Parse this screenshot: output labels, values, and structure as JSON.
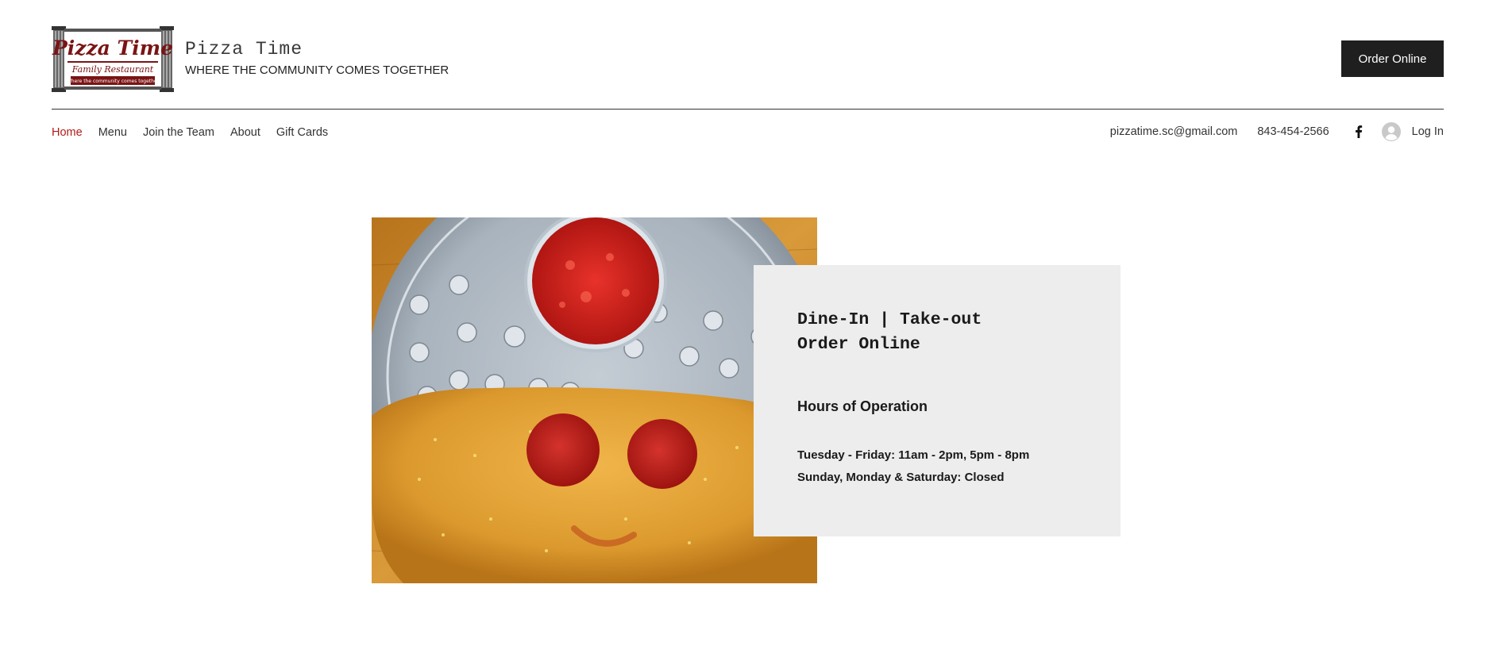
{
  "header": {
    "logo_text": "Pizza Time",
    "logo_subtitle": "Family Restaurant",
    "logo_tagline": "Where the community comes together",
    "site_name": "Pizza Time",
    "tagline": "WHERE THE COMMUNITY COMES TOGETHER",
    "order_button": "Order Online"
  },
  "nav": {
    "items": [
      {
        "label": "Home",
        "active": true
      },
      {
        "label": "Menu",
        "active": false
      },
      {
        "label": "Join the Team",
        "active": false
      },
      {
        "label": "About",
        "active": false
      },
      {
        "label": "Gift Cards",
        "active": false
      }
    ]
  },
  "contact": {
    "email": "pizzatime.sc@gmail.com",
    "phone": "843-454-2566",
    "social_icon": "facebook-icon",
    "login_label": "Log In"
  },
  "hero": {
    "image_alt": "calzone-with-marinara",
    "line1": "Dine-In | Take-out",
    "line2": "Order Online",
    "hours_title": "Hours of Operation",
    "hours": [
      "Tuesday - Friday: 11am - 2pm, 5pm - 8pm",
      "Sunday, Monday & Saturday: Closed"
    ]
  },
  "colors": {
    "accent": "#b21c17",
    "button_bg": "#1f1f1f",
    "info_box_bg": "#ededed",
    "logo_red": "#7a1414"
  }
}
